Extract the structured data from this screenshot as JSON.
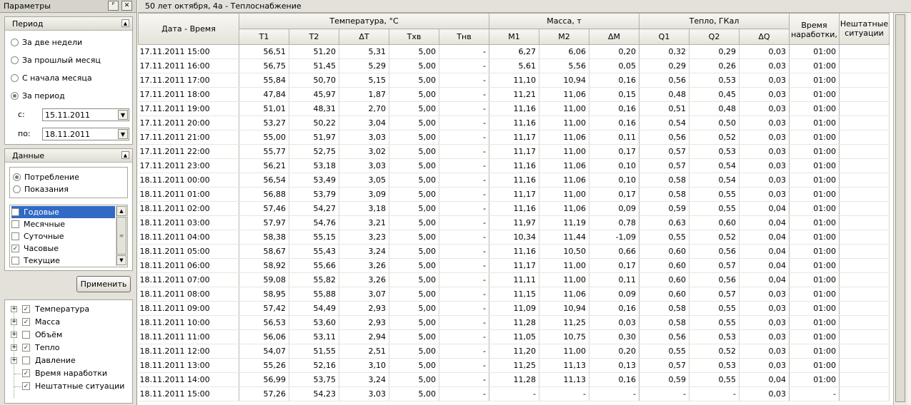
{
  "left_panel": {
    "title": "Параметры",
    "pin_glyph": "ᴾ",
    "close_glyph": "✕",
    "period": {
      "title": "Период",
      "options": [
        "За две недели",
        "За прошлый месяц",
        "С начала месяца",
        "За период"
      ],
      "selected_index": 3,
      "from_label": "с:",
      "from_value": "15.11.2011",
      "to_label": "по:",
      "to_value": "18.11.2011"
    },
    "data": {
      "title": "Данные",
      "mode_options": [
        "Потребление",
        "Показания"
      ],
      "mode_selected_index": 0,
      "archive_list": [
        {
          "label": "Годовые",
          "checked": false,
          "selected": true
        },
        {
          "label": "Месячные",
          "checked": false,
          "selected": false
        },
        {
          "label": "Суточные",
          "checked": false,
          "selected": false
        },
        {
          "label": "Часовые",
          "checked": true,
          "selected": false
        },
        {
          "label": "Текущие",
          "checked": false,
          "selected": false
        }
      ]
    },
    "apply_label": "Применить",
    "tree": [
      {
        "label": "Температура",
        "checked": true,
        "expandable": true
      },
      {
        "label": "Масса",
        "checked": true,
        "expandable": true
      },
      {
        "label": "Объём",
        "checked": false,
        "expandable": true
      },
      {
        "label": "Тепло",
        "checked": true,
        "expandable": true
      },
      {
        "label": "Давление",
        "checked": false,
        "expandable": true
      },
      {
        "label": "Время наработки",
        "checked": true,
        "expandable": false
      },
      {
        "label": "Нештатные ситуации",
        "checked": true,
        "expandable": false
      }
    ]
  },
  "main": {
    "title": "50 лет октября, 4а - Теплоснабжение",
    "headers": {
      "datetime": "Дата - Время",
      "temperature_group": "Температура, °C",
      "mass_group": "Масса, т",
      "heat_group": "Тепло, ГКал",
      "runtime": "Время наработки,",
      "emergency": "Нештатные ситуации",
      "columns": [
        "T1",
        "T2",
        "ΔT",
        "Tхв",
        "Tнв",
        "M1",
        "M2",
        "ΔM",
        "Q1",
        "Q2",
        "ΔQ"
      ]
    },
    "rows": [
      [
        "17.11.2011 15:00",
        "56,51",
        "51,20",
        "5,31",
        "5,00",
        "-",
        "6,27",
        "6,06",
        "0,20",
        "0,32",
        "0,29",
        "0,03",
        "01:00",
        ""
      ],
      [
        "17.11.2011 16:00",
        "56,75",
        "51,45",
        "5,29",
        "5,00",
        "-",
        "5,61",
        "5,56",
        "0,05",
        "0,29",
        "0,26",
        "0,03",
        "01:00",
        ""
      ],
      [
        "17.11.2011 17:00",
        "55,84",
        "50,70",
        "5,15",
        "5,00",
        "-",
        "11,10",
        "10,94",
        "0,16",
        "0,56",
        "0,53",
        "0,03",
        "01:00",
        ""
      ],
      [
        "17.11.2011 18:00",
        "47,84",
        "45,97",
        "1,87",
        "5,00",
        "-",
        "11,21",
        "11,06",
        "0,15",
        "0,48",
        "0,45",
        "0,03",
        "01:00",
        ""
      ],
      [
        "17.11.2011 19:00",
        "51,01",
        "48,31",
        "2,70",
        "5,00",
        "-",
        "11,16",
        "11,00",
        "0,16",
        "0,51",
        "0,48",
        "0,03",
        "01:00",
        ""
      ],
      [
        "17.11.2011 20:00",
        "53,27",
        "50,22",
        "3,04",
        "5,00",
        "-",
        "11,16",
        "11,00",
        "0,16",
        "0,54",
        "0,50",
        "0,03",
        "01:00",
        ""
      ],
      [
        "17.11.2011 21:00",
        "55,00",
        "51,97",
        "3,03",
        "5,00",
        "-",
        "11,17",
        "11,06",
        "0,11",
        "0,56",
        "0,52",
        "0,03",
        "01:00",
        ""
      ],
      [
        "17.11.2011 22:00",
        "55,77",
        "52,75",
        "3,02",
        "5,00",
        "-",
        "11,17",
        "11,00",
        "0,17",
        "0,57",
        "0,53",
        "0,03",
        "01:00",
        ""
      ],
      [
        "17.11.2011 23:00",
        "56,21",
        "53,18",
        "3,03",
        "5,00",
        "-",
        "11,16",
        "11,06",
        "0,10",
        "0,57",
        "0,54",
        "0,03",
        "01:00",
        ""
      ],
      [
        "18.11.2011 00:00",
        "56,54",
        "53,49",
        "3,05",
        "5,00",
        "-",
        "11,16",
        "11,06",
        "0,10",
        "0,58",
        "0,54",
        "0,03",
        "01:00",
        ""
      ],
      [
        "18.11.2011 01:00",
        "56,88",
        "53,79",
        "3,09",
        "5,00",
        "-",
        "11,17",
        "11,00",
        "0,17",
        "0,58",
        "0,55",
        "0,03",
        "01:00",
        ""
      ],
      [
        "18.11.2011 02:00",
        "57,46",
        "54,27",
        "3,18",
        "5,00",
        "-",
        "11,16",
        "11,06",
        "0,09",
        "0,59",
        "0,55",
        "0,04",
        "01:00",
        ""
      ],
      [
        "18.11.2011 03:00",
        "57,97",
        "54,76",
        "3,21",
        "5,00",
        "-",
        "11,97",
        "11,19",
        "0,78",
        "0,63",
        "0,60",
        "0,04",
        "01:00",
        ""
      ],
      [
        "18.11.2011 04:00",
        "58,38",
        "55,15",
        "3,23",
        "5,00",
        "-",
        "10,34",
        "11,44",
        "-1,09",
        "0,55",
        "0,52",
        "0,04",
        "01:00",
        ""
      ],
      [
        "18.11.2011 05:00",
        "58,67",
        "55,43",
        "3,24",
        "5,00",
        "-",
        "11,16",
        "10,50",
        "0,66",
        "0,60",
        "0,56",
        "0,04",
        "01:00",
        ""
      ],
      [
        "18.11.2011 06:00",
        "58,92",
        "55,66",
        "3,26",
        "5,00",
        "-",
        "11,17",
        "11,00",
        "0,17",
        "0,60",
        "0,57",
        "0,04",
        "01:00",
        ""
      ],
      [
        "18.11.2011 07:00",
        "59,08",
        "55,82",
        "3,26",
        "5,00",
        "-",
        "11,11",
        "11,00",
        "0,11",
        "0,60",
        "0,56",
        "0,04",
        "01:00",
        ""
      ],
      [
        "18.11.2011 08:00",
        "58,95",
        "55,88",
        "3,07",
        "5,00",
        "-",
        "11,15",
        "11,06",
        "0,09",
        "0,60",
        "0,57",
        "0,03",
        "01:00",
        ""
      ],
      [
        "18.11.2011 09:00",
        "57,42",
        "54,49",
        "2,93",
        "5,00",
        "-",
        "11,09",
        "10,94",
        "0,16",
        "0,58",
        "0,55",
        "0,03",
        "01:00",
        ""
      ],
      [
        "18.11.2011 10:00",
        "56,53",
        "53,60",
        "2,93",
        "5,00",
        "-",
        "11,28",
        "11,25",
        "0,03",
        "0,58",
        "0,55",
        "0,03",
        "01:00",
        ""
      ],
      [
        "18.11.2011 11:00",
        "56,06",
        "53,11",
        "2,94",
        "5,00",
        "-",
        "11,05",
        "10,75",
        "0,30",
        "0,56",
        "0,53",
        "0,03",
        "01:00",
        ""
      ],
      [
        "18.11.2011 12:00",
        "54,07",
        "51,55",
        "2,51",
        "5,00",
        "-",
        "11,20",
        "11,00",
        "0,20",
        "0,55",
        "0,52",
        "0,03",
        "01:00",
        ""
      ],
      [
        "18.11.2011 13:00",
        "55,26",
        "52,16",
        "3,10",
        "5,00",
        "-",
        "11,25",
        "11,13",
        "0,13",
        "0,57",
        "0,53",
        "0,03",
        "01:00",
        ""
      ],
      [
        "18.11.2011 14:00",
        "56,99",
        "53,75",
        "3,24",
        "5,00",
        "-",
        "11,28",
        "11,13",
        "0,16",
        "0,59",
        "0,55",
        "0,04",
        "01:00",
        ""
      ],
      [
        "18.11.2011 15:00",
        "57,26",
        "54,23",
        "3,03",
        "5,00",
        "-",
        "-",
        "-",
        "-",
        "-",
        "-",
        "0,03",
        "-",
        ""
      ]
    ]
  }
}
